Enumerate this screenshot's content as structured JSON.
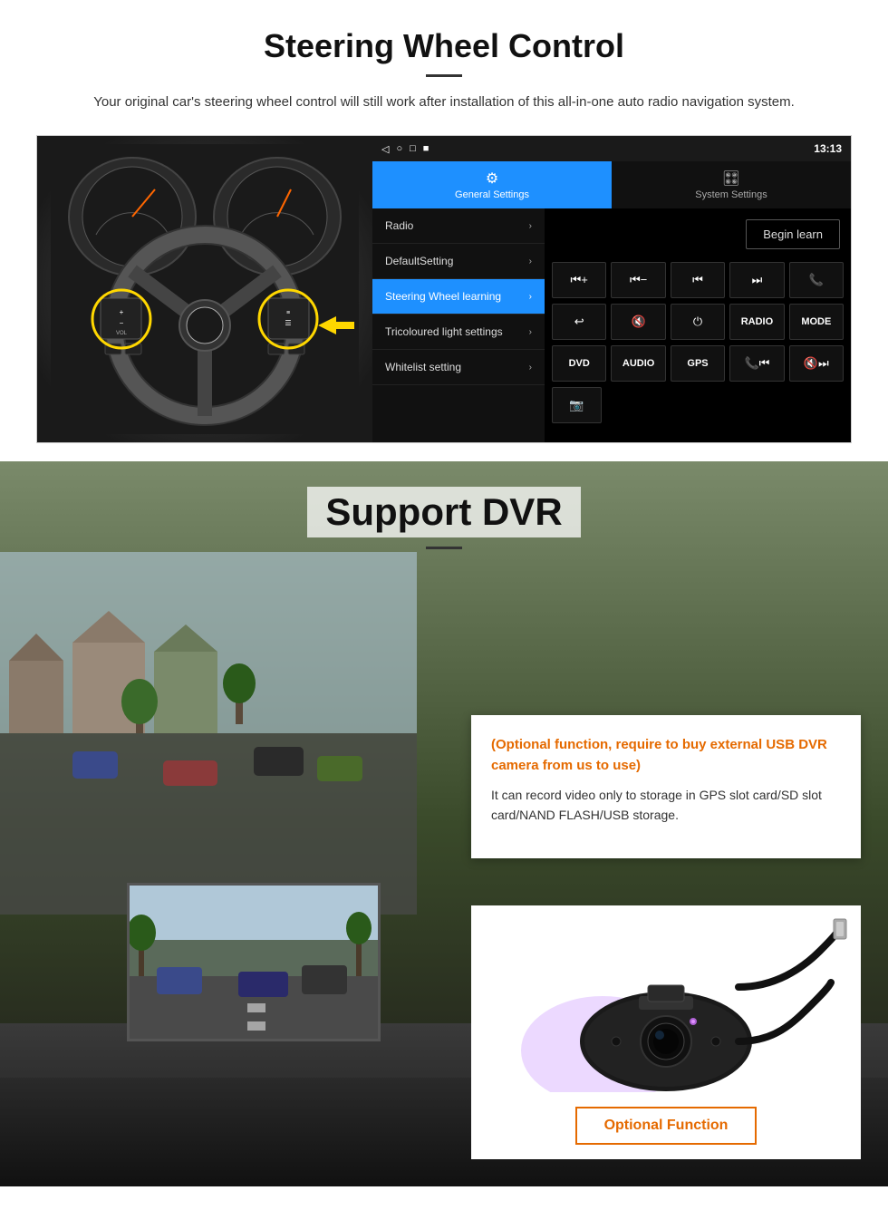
{
  "steering": {
    "title": "Steering Wheel Control",
    "subtitle": "Your original car's steering wheel control will still work after installation of this all-in-one auto radio navigation system.",
    "status_bar": {
      "icons": "◁  ○  □  ■",
      "time": "13:13",
      "signal": "▾"
    },
    "tabs": {
      "general": "General Settings",
      "system": "System Settings"
    },
    "menu_items": [
      {
        "label": "Radio",
        "active": false
      },
      {
        "label": "DefaultSetting",
        "active": false
      },
      {
        "label": "Steering Wheel learning",
        "active": true
      },
      {
        "label": "Tricoloured light settings",
        "active": false
      },
      {
        "label": "Whitelist setting",
        "active": false
      }
    ],
    "begin_learn": "Begin learn",
    "control_buttons_row1": [
      "⏮+",
      "⏮−",
      "⏮",
      "⏭",
      "📞"
    ],
    "control_buttons_row2": [
      "↩",
      "🔇",
      "⏻",
      "RADIO",
      "MODE"
    ],
    "control_buttons_row3": [
      "DVD",
      "AUDIO",
      "GPS",
      "📞⏮",
      "🔇⏭"
    ],
    "control_buttons_row4": [
      "📷"
    ]
  },
  "dvr": {
    "title": "Support DVR",
    "orange_text": "(Optional function, require to buy external USB DVR camera from us to use)",
    "description": "It can record video only to storage in GPS slot card/SD slot card/NAND FLASH/USB storage.",
    "optional_button_label": "Optional Function"
  }
}
